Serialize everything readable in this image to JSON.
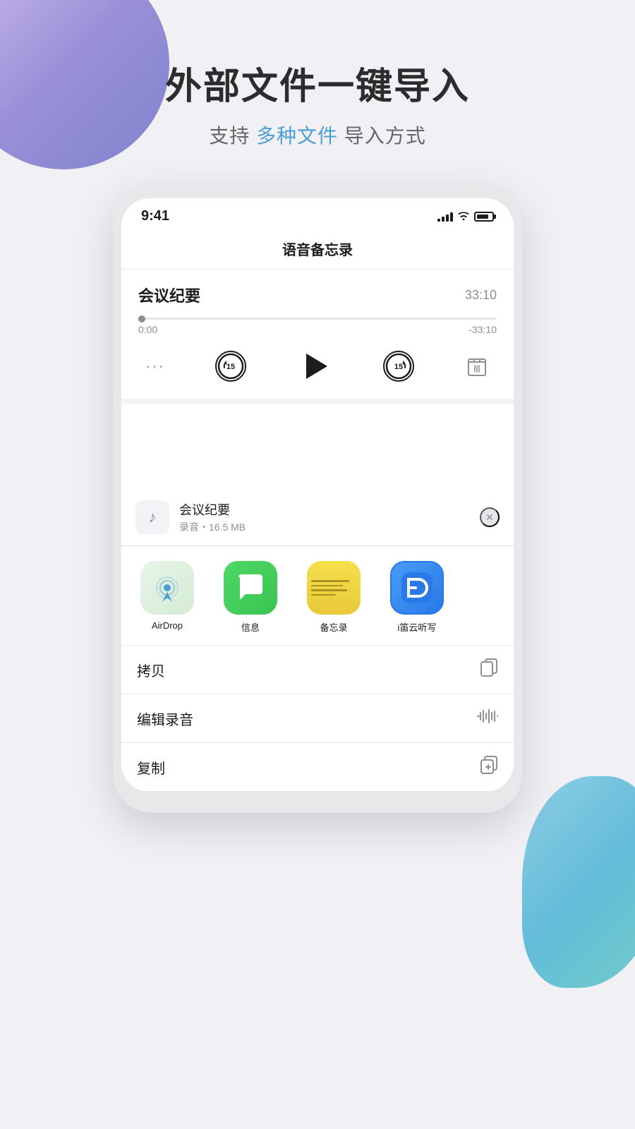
{
  "page": {
    "background_color": "#f0f0f5"
  },
  "header": {
    "title": "外部文件一键导入",
    "subtitle_before": "支持 ",
    "subtitle_highlight": "多种文件",
    "subtitle_after": " 导入方式"
  },
  "status_bar": {
    "time": "9:41",
    "signal_level": 4
  },
  "app": {
    "title": "语音备忘录"
  },
  "recording": {
    "title": "会议纪要",
    "total_duration": "33:10",
    "current_time": "0:00",
    "remaining_time": "-33:10",
    "progress_percent": 2
  },
  "controls": {
    "dots": "···",
    "skip_back_seconds": "15",
    "skip_forward_seconds": "15",
    "play_label": "play",
    "delete_label": "delete"
  },
  "share_sheet": {
    "file": {
      "name": "会议纪要",
      "type": "录音",
      "size": "16.5 MB"
    },
    "apps": [
      {
        "id": "airdrop",
        "label": "AirDrop",
        "selected": false
      },
      {
        "id": "messages",
        "label": "信息",
        "selected": false
      },
      {
        "id": "notes",
        "label": "备忘录",
        "selected": false
      },
      {
        "id": "main-app",
        "label": "i笛云听写",
        "selected": true
      }
    ],
    "actions": [
      {
        "id": "copy",
        "label": "拷贝",
        "icon": "copy"
      },
      {
        "id": "edit-audio",
        "label": "编辑录音",
        "icon": "waveform"
      },
      {
        "id": "duplicate",
        "label": "复制",
        "icon": "duplicate"
      }
    ]
  }
}
